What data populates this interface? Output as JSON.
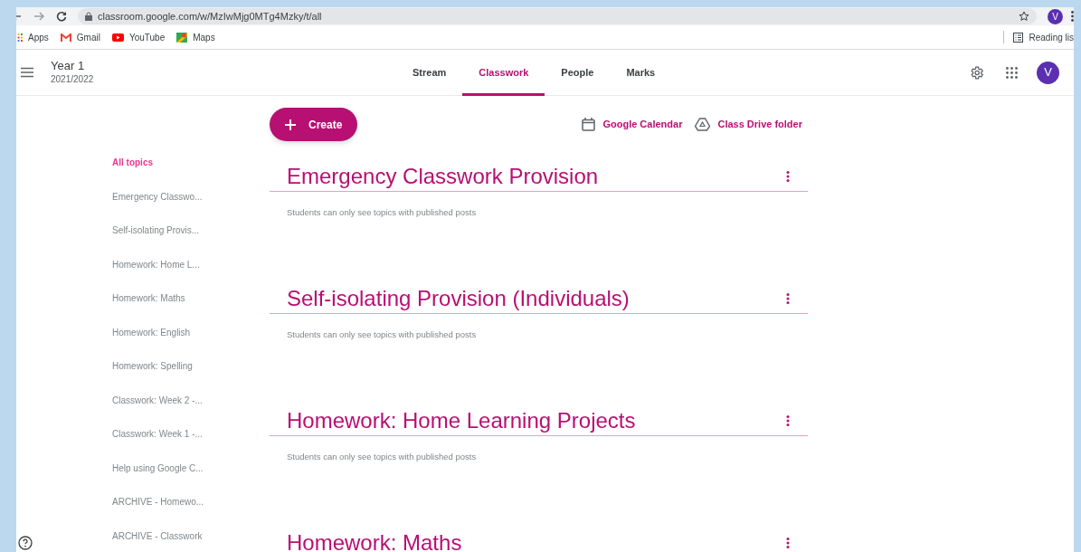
{
  "browser": {
    "url": "classroom.google.com/w/MzIwMjg0MTg4Mzky/t/all",
    "profile_initial": "V",
    "bookmarks": [
      {
        "kind": "apps",
        "label": "Apps"
      },
      {
        "kind": "gmail",
        "label": "Gmail"
      },
      {
        "kind": "youtube",
        "label": "YouTube"
      },
      {
        "kind": "maps",
        "label": "Maps"
      }
    ],
    "reading_list": "Reading lis"
  },
  "header": {
    "class_name": "Year 1",
    "section": "2021/2022",
    "avatar_initial": "V",
    "tabs": [
      {
        "label": "Stream",
        "selected": false
      },
      {
        "label": "Classwork",
        "selected": true
      },
      {
        "label": "People",
        "selected": false
      },
      {
        "label": "Marks",
        "selected": false
      }
    ]
  },
  "create_button": "Create",
  "links": [
    {
      "kind": "calendar",
      "label": "Google Calendar"
    },
    {
      "kind": "drive",
      "label": "Class Drive folder"
    }
  ],
  "sidebar": [
    {
      "label": "All topics",
      "selected": true
    },
    {
      "label": "Emergency Classwo...",
      "selected": false
    },
    {
      "label": "Self-isolating Provis...",
      "selected": false
    },
    {
      "label": "Homework: Home L...",
      "selected": false
    },
    {
      "label": "Homework: Maths",
      "selected": false
    },
    {
      "label": "Homework: English",
      "selected": false
    },
    {
      "label": "Homework: Spelling",
      "selected": false
    },
    {
      "label": "Classwork: Week 2 -...",
      "selected": false
    },
    {
      "label": "Classwork: Week 1 -...",
      "selected": false
    },
    {
      "label": "Help using Google C...",
      "selected": false
    },
    {
      "label": "ARCHIVE - Homewo...",
      "selected": false
    },
    {
      "label": "ARCHIVE - Classwork",
      "selected": false
    }
  ],
  "topics": [
    {
      "title": "Emergency Classwork Provision",
      "note": "Students can only see topics with published posts"
    },
    {
      "title": "Self-isolating Provision (Individuals)",
      "note": "Students can only see topics with published posts"
    },
    {
      "title": "Homework: Home Learning Projects",
      "note": "Students can only see topics with published posts"
    },
    {
      "title": "Homework: Maths"
    }
  ]
}
